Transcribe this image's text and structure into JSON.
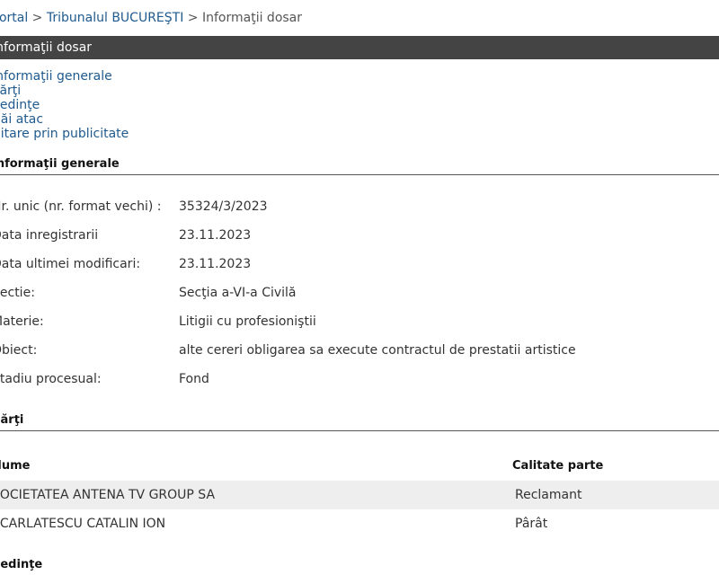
{
  "breadcrumb": {
    "items": [
      {
        "label": "Portal",
        "sep": ""
      },
      {
        "label": "Tribunalul BUCUREŞTI",
        "sep": " > "
      }
    ],
    "current_sep": " > ",
    "current": "Informaţii dosar"
  },
  "title_bar": {
    "label": "Informaţii dosar"
  },
  "toc": [
    {
      "label": "Informaţii generale"
    },
    {
      "label": "Părţi"
    },
    {
      "label": "Şedinţe"
    },
    {
      "label": "Căi atac"
    },
    {
      "label": "Citare prin publicitate"
    }
  ],
  "general": {
    "heading": "Informaţii generale",
    "fields": [
      {
        "label": "Nr. unic (nr. format vechi) :",
        "value": "35324/3/2023"
      },
      {
        "label": "Data inregistrarii",
        "value": "23.11.2023"
      },
      {
        "label": "Data ultimei modificari:",
        "value": "23.11.2023"
      },
      {
        "label": "Sectie:",
        "value": "Secţia a-VI-a Civilă"
      },
      {
        "label": "Materie:",
        "value": "Litigii cu profesioniştii"
      },
      {
        "label": "Obiect:",
        "value": "alte cereri obligarea sa execute contractul de prestatii artistice"
      },
      {
        "label": "Stadiu procesual:",
        "value": "Fond"
      }
    ]
  },
  "parties": {
    "heading": "Părţi",
    "columns": [
      "Nume",
      "Calitate parte"
    ],
    "rows": [
      {
        "name": "SOCIETATEA ANTENA TV GROUP SA",
        "role": "Reclamant"
      },
      {
        "name": "SCARLATESCU CATALIN ION",
        "role": "Pârât"
      }
    ]
  },
  "hearings": {
    "heading": "Şedinţe"
  }
}
